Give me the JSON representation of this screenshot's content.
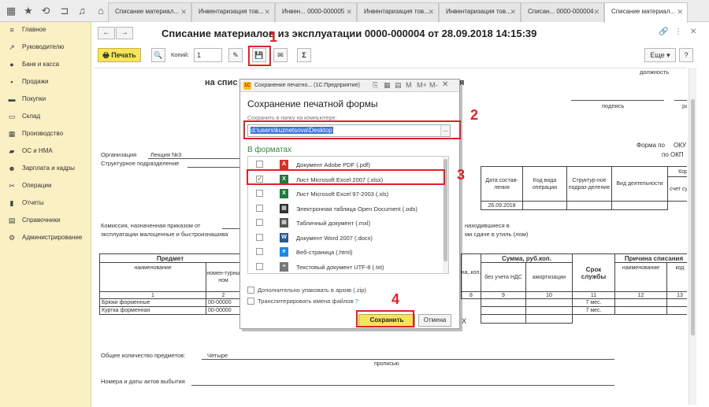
{
  "tabs": [
    {
      "label": "Списание материал...",
      "active": false
    },
    {
      "label": "Инвентаризация тов...",
      "active": false
    },
    {
      "label": "Инвен... 0000-000005",
      "active": false
    },
    {
      "label": "Инвентаризация тов...",
      "active": false
    },
    {
      "label": "Инвентаризация тов...",
      "active": false
    },
    {
      "label": "Списан... 0000-000004",
      "active": false
    },
    {
      "label": "Списание материал...",
      "active": true
    }
  ],
  "sidebar": {
    "items": [
      {
        "label": "Главное",
        "icon": "menu-icon"
      },
      {
        "label": "Руководителю",
        "icon": "trend-icon"
      },
      {
        "label": "Банк и касса",
        "icon": "coin-icon"
      },
      {
        "label": "Продажи",
        "icon": "bag-icon"
      },
      {
        "label": "Покупки",
        "icon": "cart-icon"
      },
      {
        "label": "Склад",
        "icon": "warehouse-icon"
      },
      {
        "label": "Производство",
        "icon": "factory-icon"
      },
      {
        "label": "ОС и НМА",
        "icon": "truck-icon"
      },
      {
        "label": "Зарплата и кадры",
        "icon": "people-icon"
      },
      {
        "label": "Операции",
        "icon": "operations-icon"
      },
      {
        "label": "Отчеты",
        "icon": "chart-icon"
      },
      {
        "label": "Справочники",
        "icon": "book-icon"
      },
      {
        "label": "Администрирование",
        "icon": "gear-icon"
      }
    ]
  },
  "document": {
    "title": "Списание материалов из эксплуатации 0000-000004 от 28.09.2018 14:15:39",
    "print_label": "Печать",
    "copies_label": "Копий:",
    "copies_value": "1",
    "more_label": "Еще",
    "help_label": "?",
    "sum_label": "Σ"
  },
  "report": {
    "heading_partial": "на спис",
    "heading_tail": "я",
    "dolzhnost": "должность",
    "podpis": "подпись",
    "ra": "ра",
    "forma_po": "Форма по",
    "okud": "ОКУ",
    "po_okp": "по ОКП",
    "org_label": "Организация",
    "org_value": "Лекция №3",
    "dept_label": "Структурное подразделение",
    "h_date": "Дата состав-ления",
    "h_kod": "Код вида операции",
    "h_struct": "Структур-ное подраз-деление",
    "h_vid": "Вид деятельности",
    "h_kor": "Кор",
    "h_schet": "счет субсч",
    "date_value": "26.09.2018",
    "commission_1": "Комиссия, назначенная приказом от",
    "commission_1b": "находившиеся в",
    "commission_2": "эксплуатации малоценные и быстроизнашива",
    "commission_2b": "ми сдаче в утиль (лом)",
    "th_predmet": "Предмет",
    "th_name": "наименование",
    "th_nomen": "номен-турны ном",
    "th_na": "на,",
    "th_kop": ".коп.",
    "th_sum": "Сумма, руб.коп.",
    "th_bez": "без учета НДС",
    "th_amort": "амортизации",
    "th_srok": "Срок службы",
    "th_prichina": "Причина списания",
    "th_name2": "наименование",
    "th_kod2": "код",
    "col_nums": [
      "1",
      "2",
      "8",
      "9",
      "10",
      "11",
      "12",
      "13"
    ],
    "rows": [
      {
        "name": "Брюки форменные",
        "nomen": "00-00000",
        "srok": "7 мес."
      },
      {
        "name": "Куртка форменная",
        "nomen": "00-00000",
        "srok": "7 мес."
      }
    ],
    "x_mark": "X",
    "total_label": "Общее количество предметов:",
    "total_value": "Четыре",
    "propisyu": "прописью",
    "acts_label": "Номера и даты актов выбытия"
  },
  "dialog": {
    "window_title": "Сохранение печатно... (1С:Предприятие)",
    "heading": "Сохранение печатной формы",
    "save_to_label": "Сохранить в папку на компьютере:",
    "path_value": "d:\\users\\kuznetsova\\Desktop",
    "browse_label": "...",
    "formats_label": "В форматах",
    "formats": [
      {
        "label": "Документ Adobe PDF (.pdf)",
        "checked": false,
        "icon": "pdf-icon",
        "badge": "A",
        "color": "#d9312b"
      },
      {
        "label": "Лист Microsoft Excel 2007 (.xlsx)",
        "checked": true,
        "icon": "excel-icon",
        "badge": "X",
        "color": "#1f7a3a"
      },
      {
        "label": "Лист Microsoft Excel 97-2003 (.xls)",
        "checked": false,
        "icon": "excel-icon",
        "badge": "X",
        "color": "#1f7a3a"
      },
      {
        "label": "Электронная таблица Open Document (.ods)",
        "checked": false,
        "icon": "ods-icon",
        "badge": "▦",
        "color": "#333333"
      },
      {
        "label": "Табличный документ (.mxl)",
        "checked": false,
        "icon": "mxl-icon",
        "badge": "▦",
        "color": "#555555"
      },
      {
        "label": "Документ Word 2007 (.docx)",
        "checked": false,
        "icon": "word-icon",
        "badge": "W",
        "color": "#2b579a"
      },
      {
        "label": "Веб-страница (.html)",
        "checked": false,
        "icon": "ie-icon",
        "badge": "e",
        "color": "#1e88e5"
      },
      {
        "label": "Текстовый документ UTF-8 (.txt)",
        "checked": false,
        "icon": "txt-icon",
        "badge": "≡",
        "color": "#777777"
      }
    ],
    "zip_option": "Дополнительно упаковать в архив (.zip)",
    "translit_option": "Транслитерировать имена файлов",
    "save_button": "Сохранить",
    "cancel_button": "Отмена"
  },
  "annotations": [
    "1",
    "2",
    "3",
    "4"
  ],
  "colors": {
    "annotation": "#e22027",
    "sidebar": "#fbefc4",
    "accent_button": "#f6e45c",
    "formats_label": "#2f8a3a"
  }
}
